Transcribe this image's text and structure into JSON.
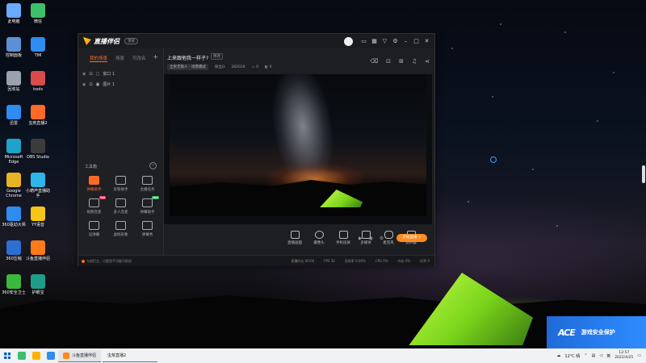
{
  "desktop": {
    "icons": [
      {
        "label": "此电脑",
        "icon": "computer-icon",
        "color": "#6aa9ff"
      },
      {
        "label": "微信",
        "icon": "wechat-icon",
        "color": "#3cc06a"
      },
      {
        "label": "控制面板",
        "icon": "control-panel-icon",
        "color": "#5e8fd6"
      },
      {
        "label": "TIM",
        "icon": "tim-icon",
        "color": "#2f8cf0"
      },
      {
        "label": "回收站",
        "icon": "recycle-bin-icon",
        "color": "#9aa3ad"
      },
      {
        "label": "tools",
        "icon": "tools-icon",
        "color": "#d84b4b"
      },
      {
        "label": "迅雷",
        "icon": "xunlei-icon",
        "color": "#2f8cf0"
      },
      {
        "label": "虫荒直播2",
        "icon": "stream-app-icon",
        "color": "#ff6a2a"
      },
      {
        "label": "Microsoft Edge",
        "icon": "edge-icon",
        "color": "#1fa3c8"
      },
      {
        "label": "OBS Studio",
        "icon": "obs-icon",
        "color": "#3b3b3b"
      },
      {
        "label": "Google Chrome",
        "icon": "chrome-icon",
        "color": "#e8b423"
      },
      {
        "label": "小葫芦直播助手",
        "icon": "gourd-icon",
        "color": "#2fb6e8"
      },
      {
        "label": "360驱动大师",
        "icon": "driver-master-icon",
        "color": "#2f8cf0"
      },
      {
        "label": "YY语音",
        "icon": "yy-icon",
        "color": "#f5c518"
      },
      {
        "label": "360压缩",
        "icon": "zip-360-icon",
        "color": "#2a6fd1"
      },
      {
        "label": "斗鱼直播伴侣",
        "icon": "douyu-icon",
        "color": "#ff7a1a"
      },
      {
        "label": "360安全卫士",
        "icon": "security-360-icon",
        "color": "#3cb83c"
      },
      {
        "label": "护眼宝",
        "icon": "eye-care-icon",
        "color": "#1e9e8a"
      }
    ]
  },
  "app": {
    "name": "直播伴侣",
    "version_chip": "测试",
    "left": {
      "tabs": [
        "我的场景",
        "场景",
        "可改名"
      ],
      "sources": [
        {
          "label": "窗口 1"
        },
        {
          "label": "图片 1"
        }
      ],
      "tools_title": "工具箱",
      "tools": [
        {
          "label": "弹幕助手",
          "badge": "",
          "active": true
        },
        {
          "label": "房管助手",
          "badge": "",
          "active": false
        },
        {
          "label": "主播任务",
          "badge": "",
          "active": false
        },
        {
          "label": "视频连麦",
          "badge": "hot",
          "active": false
        },
        {
          "label": "多人连麦",
          "badge": "",
          "active": false
        },
        {
          "label": "弹幕助手",
          "badge": "new",
          "active": false
        },
        {
          "label": "设弹幕",
          "badge": "",
          "active": false
        },
        {
          "label": "虚拟形象",
          "badge": "",
          "active": false
        },
        {
          "label": "弹幕秀",
          "badge": "",
          "active": false
        }
      ]
    },
    "top": {
      "room_title": "上来跟他我一样子?",
      "room_chip": "修改",
      "category": "全民无限人 - 场景模式",
      "fans": "粉丝Ω",
      "room_id": "282026",
      "likes": "0",
      "viewers": "0"
    },
    "bottom": {
      "buttons": [
        "直播画面",
        "摄像头",
        "手机投屏",
        "多媒体",
        "麦克风",
        "扬声器"
      ],
      "go_live": "开始直播 ▽"
    },
    "status": {
      "message": "与他们主，讨更直手功能可前进",
      "stats": [
        "直播时长 00:00",
        "FPS 30",
        "丢帧率 0.00%",
        "CPU 0%",
        "内存 0%",
        "码率 0"
      ]
    }
  },
  "promo": {
    "logo": "ACE",
    "text": "游戏安全保护"
  },
  "taskbar": {
    "tasks": [
      {
        "label": "斗鱼直播伴侣"
      },
      {
        "label": "虫荒直播2"
      }
    ],
    "weather": "12°C 晴",
    "time": "12:57",
    "date": "2022/4/25"
  }
}
